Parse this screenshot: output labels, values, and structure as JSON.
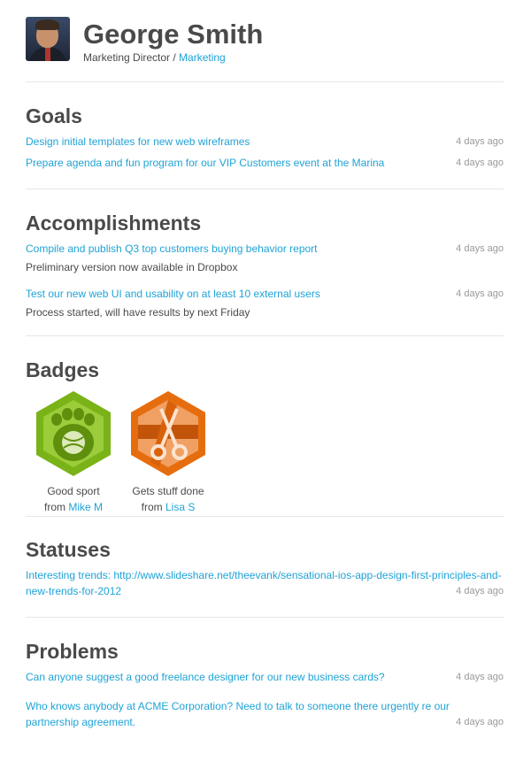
{
  "profile": {
    "name": "George Smith",
    "role": "Marketing Director /",
    "department": "Marketing"
  },
  "goals": {
    "title": "Goals",
    "items": [
      {
        "text": "Design initial templates for new web wireframes",
        "ago": "4 days ago"
      },
      {
        "text": "Prepare agenda and fun program for our VIP Customers event at the Marina",
        "ago": "4 days ago"
      }
    ]
  },
  "accomplishments": {
    "title": "Accomplishments",
    "items": [
      {
        "text": "Compile and publish Q3 top customers buying behavior report",
        "note": "Preliminary version now available in Dropbox",
        "ago": "4 days ago"
      },
      {
        "text": "Test our new web UI and usability on at least 10 external users",
        "note": "Process started, will have results by next Friday",
        "ago": "4 days ago"
      }
    ]
  },
  "badges": {
    "title": "Badges",
    "items": [
      {
        "name": "Good sport",
        "from_label": "from",
        "from": "Mike M",
        "icon": "footprint-ball-icon",
        "color": "#7ab317",
        "dark": "#5e8f0d"
      },
      {
        "name": "Gets stuff done",
        "from_label": "from",
        "from": "Lisa S",
        "icon": "scissors-ribbon-icon",
        "color": "#e66d0e",
        "dark": "#c2540a"
      }
    ]
  },
  "statuses": {
    "title": "Statuses",
    "items": [
      {
        "text": "Interesting trends: http://www.slideshare.net/theevank/sensational-ios-app-design-first-principles-and-new-trends-for-2012",
        "ago": "4 days ago"
      }
    ]
  },
  "problems": {
    "title": "Problems",
    "items": [
      {
        "text": "Can anyone suggest a good freelance designer for our new business cards?",
        "ago": "4 days ago"
      },
      {
        "text": "Who knows anybody at ACME Corporation? Need to talk to someone there urgently re our partnership agreement.",
        "ago": "4 days ago"
      }
    ]
  },
  "colors": {
    "accent": "#1fa3d6",
    "muted": "#999999",
    "text": "#4a4a4a"
  }
}
